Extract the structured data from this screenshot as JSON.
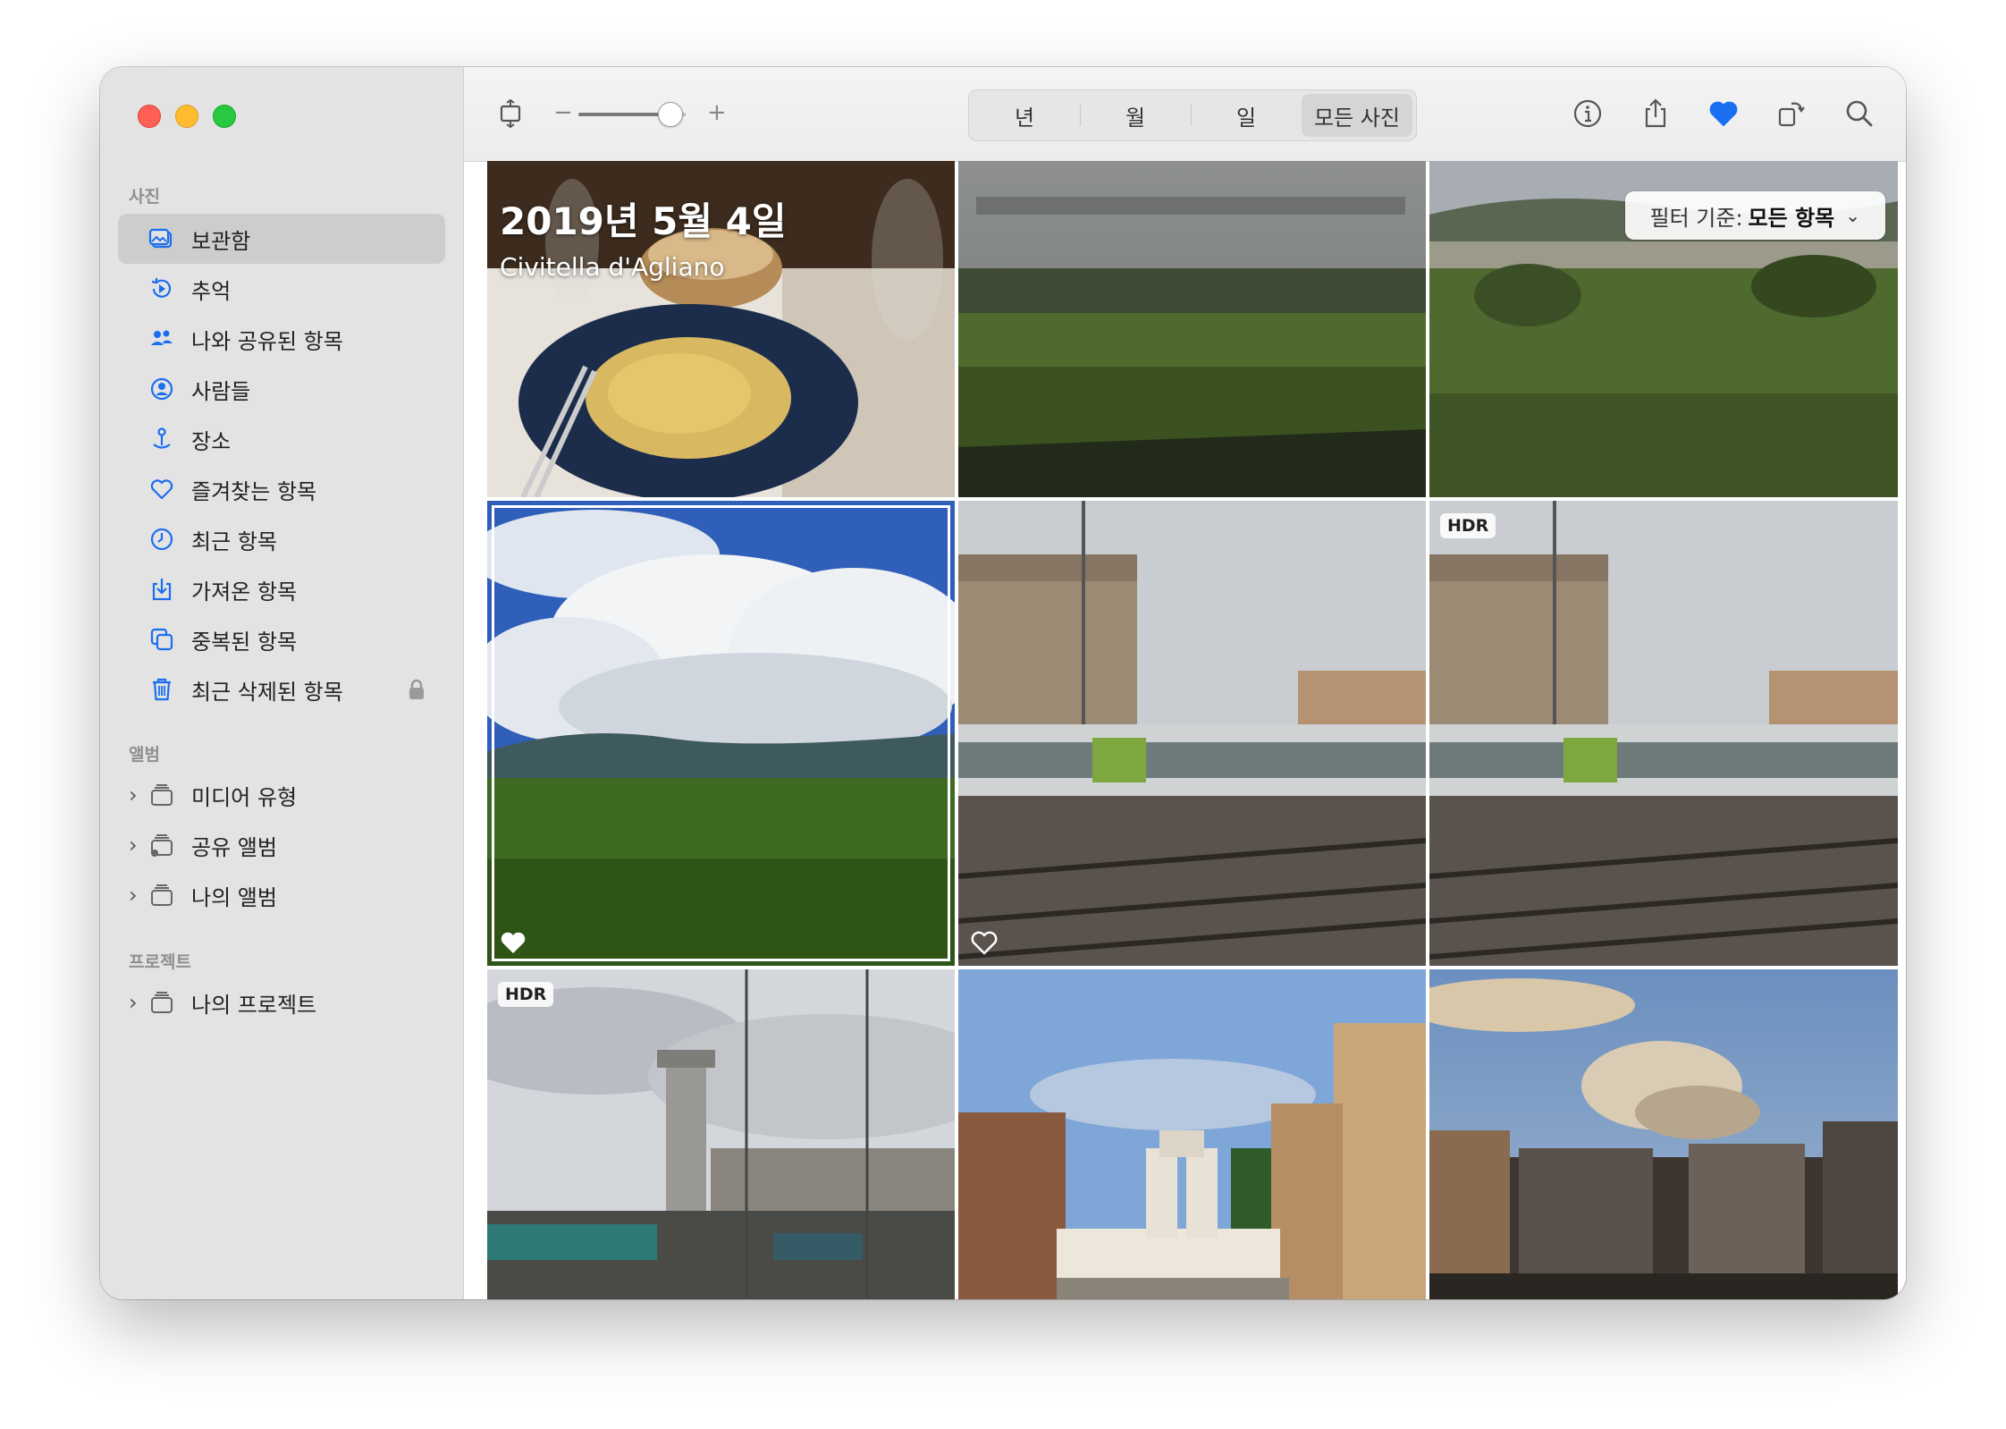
{
  "window": {
    "traffic_lights": [
      "close",
      "minimize",
      "zoom"
    ]
  },
  "sidebar": {
    "section_photos": "사진",
    "items": [
      {
        "label": "보관함",
        "icon": "library-icon",
        "selected": true
      },
      {
        "label": "추억",
        "icon": "memories-icon"
      },
      {
        "label": "나와 공유된 항목",
        "icon": "shared-with-you-icon"
      },
      {
        "label": "사람들",
        "icon": "people-icon"
      },
      {
        "label": "장소",
        "icon": "places-icon"
      },
      {
        "label": "즐겨찾는 항목",
        "icon": "favorites-heart-icon"
      },
      {
        "label": "최근 항목",
        "icon": "recents-clock-icon"
      },
      {
        "label": "가져온 항목",
        "icon": "imports-icon"
      },
      {
        "label": "중복된 항목",
        "icon": "duplicates-icon"
      },
      {
        "label": "최근 삭제된 항목",
        "icon": "trash-icon",
        "locked": true
      }
    ],
    "section_albums": "앨범",
    "albums": [
      {
        "label": "미디어 유형",
        "icon": "album-stack-icon"
      },
      {
        "label": "공유 앨범",
        "icon": "shared-album-icon"
      },
      {
        "label": "나의 앨범",
        "icon": "album-stack-icon"
      }
    ],
    "section_projects": "프로젝트",
    "projects": [
      {
        "label": "나의 프로젝트",
        "icon": "album-stack-icon"
      }
    ]
  },
  "toolbar": {
    "zoom_minus": "−",
    "zoom_plus": "+",
    "zoom_level": 0.85,
    "segments": [
      "년",
      "월",
      "일",
      "모든 사진"
    ],
    "active_segment": "모든 사진",
    "icons": [
      "info-icon",
      "share-icon",
      "favorite-heart-icon",
      "rotate-icon",
      "search-icon"
    ]
  },
  "content": {
    "date_title": "2019년 5월 4일",
    "date_subtitle": "Civitella d'Agliano",
    "filter_label": "필터 기준:",
    "filter_value": "모든 항목",
    "photos": [
      {
        "desc": "pasta-dinner",
        "badge": "",
        "favorite": false
      },
      {
        "desc": "train-window-field",
        "badge": "",
        "favorite": false
      },
      {
        "desc": "hill-town-field",
        "badge": "",
        "favorite": false
      },
      {
        "desc": "clouds-landscape",
        "badge": "",
        "favorite": true,
        "selected": true
      },
      {
        "desc": "station-trains",
        "badge": "",
        "favorite": true
      },
      {
        "desc": "station-trains-hdr",
        "badge": "HDR",
        "favorite": false
      },
      {
        "desc": "rail-yard-tower",
        "badge": "HDR",
        "favorite": false
      },
      {
        "desc": "spanish-steps",
        "badge": "",
        "favorite": false
      },
      {
        "desc": "rome-rooftops",
        "badge": "",
        "favorite": false
      }
    ]
  }
}
